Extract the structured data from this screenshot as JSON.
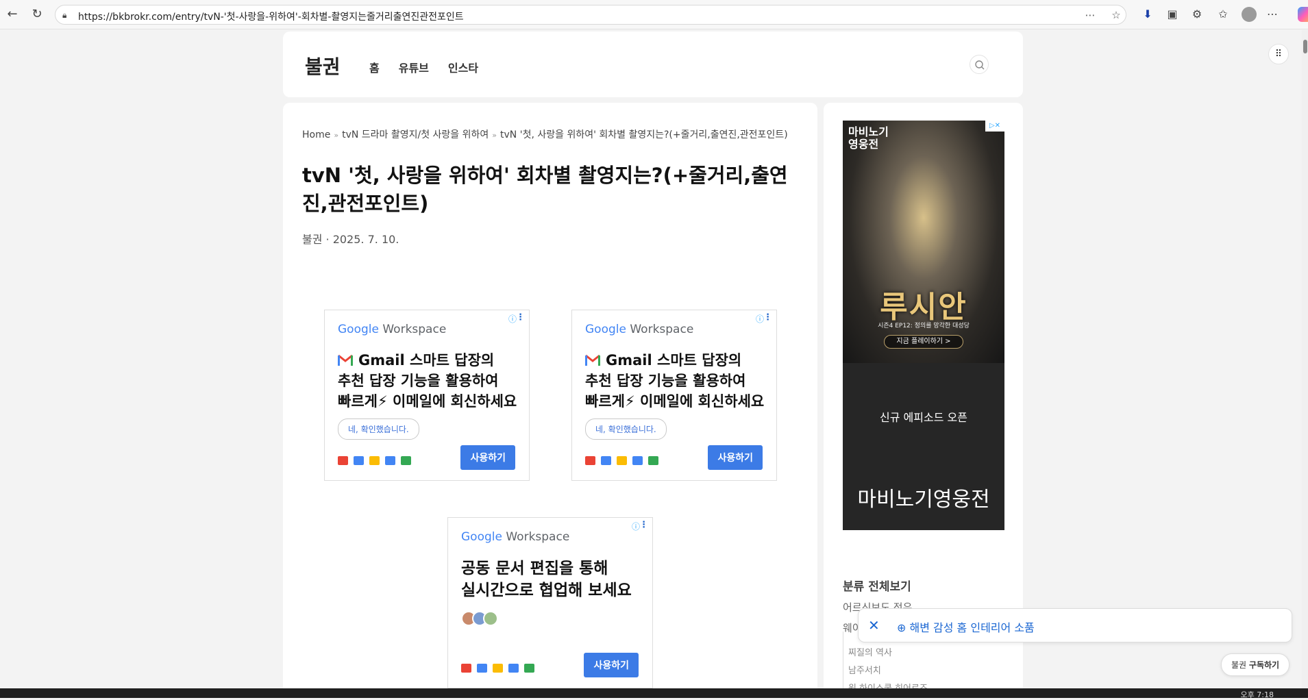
{
  "browser": {
    "url": "https://bkbrokr.com/entry/tvN-'첫-사랑을-위하여'-회차별-촬영지는줄거리출연진관전포인트"
  },
  "blog": {
    "logo": "불권",
    "menu": [
      "홈",
      "유튜브",
      "인스타"
    ]
  },
  "article": {
    "breadcrumb": [
      "Home",
      "tvN 드라마 촬영지/첫 사랑을 위하여",
      "tvN '첫, 사랑을 위하여' 회차별 촬영지는?(+줄거리,출연진,관전포인트)"
    ],
    "breadcrumb_sep": "»",
    "title": "tvN '첫, 사랑을 위하여' 회차별 촬영지는?(+줄거리,출연진,관전포인트)",
    "meta": "불권 · 2025. 7. 10."
  },
  "ads": {
    "brand_google": "Google",
    "brand_workspace": "Workspace",
    "ad1": {
      "headline": [
        "Gmail 스마트 답장의",
        "추천 답장 기능을 활용하여",
        "빠르게⚡ 이메일에 회신하세요"
      ],
      "chip": "네, 확인했습니다.",
      "cta": "사용하기"
    },
    "ad2": {
      "headline": [
        "Gmail 스마트 답장의",
        "추천 답장 기능을 활용하여",
        "빠르게⚡ 이메일에 회신하세요"
      ],
      "chip": "네, 확인했습니다.",
      "cta": "사용하기"
    },
    "ad3": {
      "headline": [
        "공동 문서 편집을 통해",
        "실시간으로 협업해 보세요"
      ],
      "cta": "사용하기"
    }
  },
  "sidebar": {
    "ad": {
      "brand_small": "마비노기\n영웅전",
      "headline": "루시안",
      "sub": "시즌4 EP12: 정의를 망각한 대성당",
      "play": "지금 플레이하기 >",
      "episode": "신규 에피소드 오픈",
      "brand_large": "마비노기영웅전"
    },
    "categories_title": "분류 전체보기",
    "categories": [
      "어르신보도 정유",
      "웨이"
    ],
    "subcategories": [
      "찌질의 역사",
      "남주서치",
      "원 하이스쿨 히어로즈"
    ]
  },
  "toast": {
    "link": "해변 감성 홈 인테리어 소품"
  },
  "subscribe": {
    "name": "불권",
    "label": "구독하기"
  },
  "taskbar": {
    "time": "오후 7:18"
  }
}
